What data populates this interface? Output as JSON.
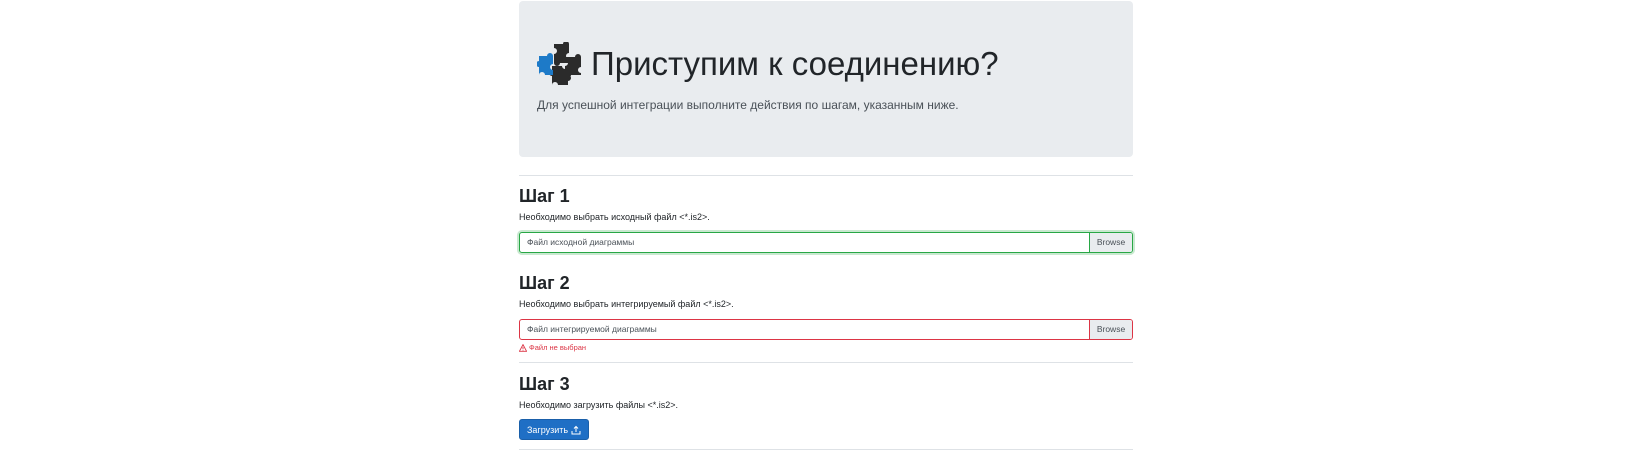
{
  "hero": {
    "title": "Приступим к соединению?",
    "lead": "Для успешной интеграции выполните действия по шагам, указанным ниже.",
    "icon": "puzzle-icon"
  },
  "steps": [
    {
      "title": "Шаг 1",
      "description": "Необходимо выбрать исходный файл <*.is2>.",
      "file_placeholder": "Файл исходной диаграммы",
      "browse_label": "Browse",
      "state": "valid"
    },
    {
      "title": "Шаг 2",
      "description": "Необходимо выбрать интегрируемый файл <*.is2>.",
      "file_placeholder": "Файл интегрируемой диаграммы",
      "browse_label": "Browse",
      "state": "invalid",
      "error": "Файл не выбран"
    },
    {
      "title": "Шаг 3",
      "description": "Необходимо загрузить файлы <*.is2>.",
      "button_label": "Загрузить",
      "button_icon": "upload-icon"
    }
  ],
  "colors": {
    "hero_bg": "#e9ecef",
    "valid": "#28a745",
    "invalid": "#dc3545",
    "primary": "#1f6fc5",
    "puzzle_blue": "#1d7ac8",
    "puzzle_dark": "#2b2b2b"
  }
}
